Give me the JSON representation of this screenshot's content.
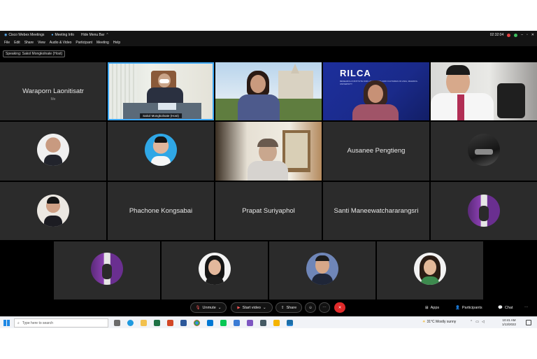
{
  "window": {
    "app_title": "Cisco Webex Meetings",
    "meeting_info": "Meeting Info",
    "hide_menu_bar": "Hide Menu Bar",
    "clock": "02:32:04"
  },
  "menu": [
    "File",
    "Edit",
    "Share",
    "View",
    "Audio & Video",
    "Participant",
    "Meeting",
    "Help"
  ],
  "speaking": "Speaking: Sakol Mongkolnate (Host)",
  "tiles": {
    "waraporn": {
      "name": "Waraporn Laonitisatr",
      "sub": "Me"
    },
    "host_label": "Sakol Mongkolnate (Host)",
    "ausanee": {
      "name": "Ausanee Pengtieng"
    },
    "phachone": {
      "name": "Phachone Kongsabai"
    },
    "prapat": {
      "name": "Prapat Suriyaphol"
    },
    "santi": {
      "name": "Santi Maneewatchararangsri"
    },
    "rilca_logo": "RILCA",
    "rilca_sub": "RESEARCH INSTITUTE FOR LANGUAGES AND CULTURES OF ASIA, MAHIDOL UNIVERSITY"
  },
  "controls": {
    "unmute": "Unmute",
    "start_video": "Start video",
    "share": "Share",
    "apps": "Apps",
    "participants": "Participants",
    "chat": "Chat"
  },
  "taskbar": {
    "search_placeholder": "Type here to search",
    "weather": "31°C  Mostly sunny",
    "time": "10:41 AM",
    "date": "1/13/2022"
  },
  "colors": {
    "tile_bg": "#2b2b2b",
    "active_border": "#3fa9f5",
    "end_button": "#e02a2a",
    "rilca_bg": "#1a2a8a"
  }
}
